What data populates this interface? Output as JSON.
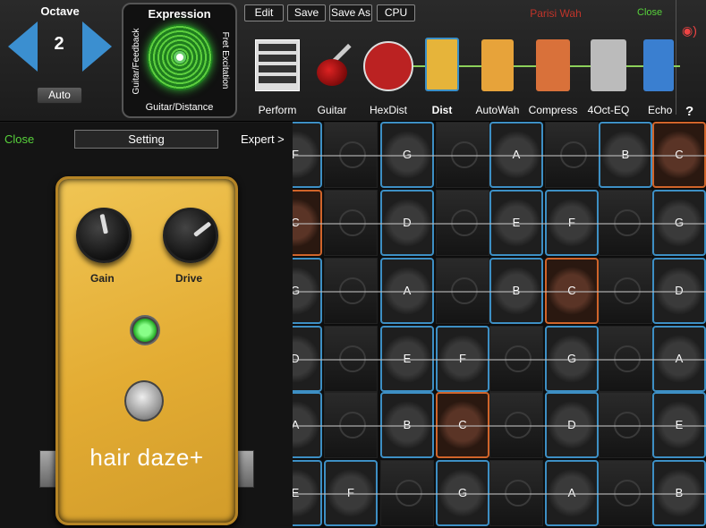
{
  "octave": {
    "title": "Octave",
    "value": "2",
    "auto_label": "Auto"
  },
  "expression": {
    "title": "Expression",
    "left_label": "Guitar/Feedback",
    "bottom_label": "Guitar/Distance",
    "right_label": "Fret Excitation"
  },
  "toolbar": {
    "edit": "Edit",
    "save": "Save",
    "save_as": "Save As",
    "cpu": "CPU"
  },
  "preset_name": "Parisi Wah",
  "close_top": "Close",
  "help": "?",
  "chain": [
    {
      "label": "Perform",
      "icon": "perform-icon"
    },
    {
      "label": "Guitar",
      "icon": "guitar-icon"
    },
    {
      "label": "HexDist",
      "icon": "hexdist-pedal-icon"
    },
    {
      "label": "Dist",
      "icon": "dist-pedal-icon",
      "active": true
    },
    {
      "label": "AutoWah",
      "icon": "autowah-pedal-icon"
    },
    {
      "label": "Compress",
      "icon": "compress-pedal-icon"
    },
    {
      "label": "4Oct-EQ",
      "icon": "eq-pedal-icon"
    },
    {
      "label": "Echo",
      "icon": "echo-pedal-icon"
    }
  ],
  "left_panel": {
    "close": "Close",
    "setting": "Setting",
    "expert": "Expert >",
    "pedal": {
      "gain_label": "Gain",
      "drive_label": "Drive",
      "name": "hair daze+",
      "gain_level": 0.45,
      "drive_level": 0.72,
      "color": "#e8b53f"
    }
  },
  "fretboard": {
    "rows": [
      [
        "F",
        "",
        "G",
        "",
        "A",
        "",
        "B",
        "C"
      ],
      [
        "C",
        "",
        "D",
        "",
        "E",
        "F",
        "",
        "G"
      ],
      [
        "G",
        "",
        "A",
        "",
        "B",
        "C",
        "",
        "D"
      ],
      [
        "D",
        "",
        "E",
        "F",
        "",
        "G",
        "",
        "A"
      ],
      [
        "A",
        "",
        "B",
        "C",
        "",
        "D",
        "",
        "E"
      ],
      [
        "E",
        "F",
        "",
        "G",
        "",
        "A",
        "",
        "B"
      ]
    ],
    "highlight": [
      [
        0,
        7
      ],
      [
        1,
        0
      ],
      [
        2,
        5
      ],
      [
        4,
        3
      ]
    ],
    "accent_blue": "#3d8fc4",
    "accent_orange": "#d0642a"
  }
}
